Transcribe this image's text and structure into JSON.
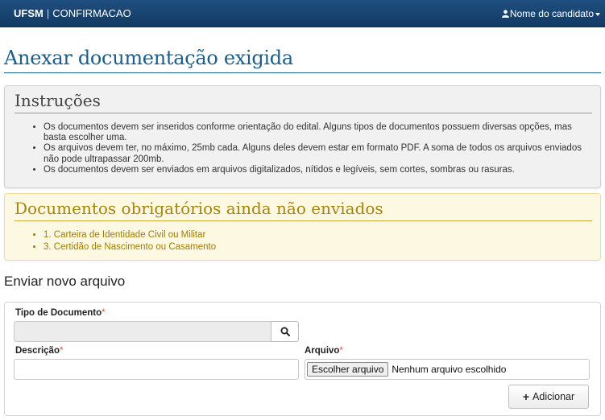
{
  "navbar": {
    "brand_strong": "UFSM",
    "separator": "|",
    "brand_sub": "CONFIRMACAO",
    "user_label": "Nome do candidato",
    "icons": {
      "user": "user-icon",
      "caret": "caret-down-icon"
    }
  },
  "page": {
    "title": "Anexar documentação exigida"
  },
  "instructions": {
    "heading": "Instruções",
    "items": [
      "Os documentos devem ser inseridos conforme orientação do edital. Alguns tipos de documentos possuem diversas opções, mas basta escolher uma.",
      "Os arquivos devem ter, no máximo, 25mb cada. Alguns deles devem estar em formato PDF. A soma de todos os arquivos enviados não pode ultrapassar 200mb.",
      "Os documentos devem ser enviados em arquivos digitalizados, nítidos e legíveis, sem cortes, sombras ou rasuras."
    ]
  },
  "pending": {
    "heading": "Documentos obrigatórios ainda não enviados",
    "items": [
      "1. Carteira de Identidade Civil ou Militar",
      "3. Certidão de Nascimento ou Casamento"
    ]
  },
  "upload": {
    "section_title": "Enviar novo arquivo",
    "tipo_label": "Tipo de Documento",
    "tipo_value": "",
    "descricao_label": "Descrição",
    "descricao_value": "",
    "arquivo_label": "Arquivo",
    "file_button": "Escolher arquivo",
    "file_status": "Nenhum arquivo escolhido",
    "required_mark": "*",
    "add_button": "Adicionar",
    "icons": {
      "search": "search-icon",
      "plus": "plus-icon"
    }
  },
  "colors": {
    "navbar": "#1a4a78",
    "title": "#1d5d88",
    "warning_bg": "#fdf8e1",
    "warning_text": "#a5850d",
    "required": "#d9534f"
  }
}
